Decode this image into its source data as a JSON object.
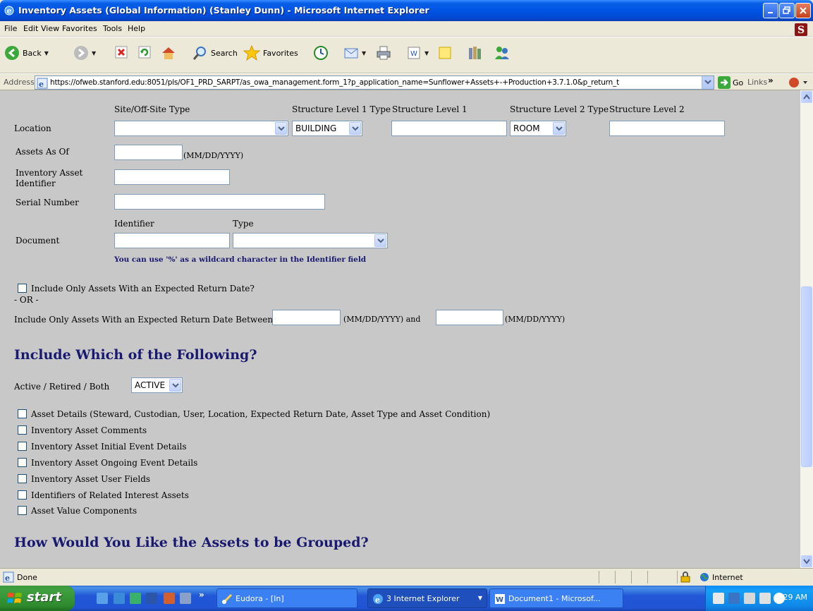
{
  "window": {
    "title": "Inventory Assets (Global Information) (Stanley Dunn) - Microsoft Internet Explorer"
  },
  "menu": [
    "File",
    "Edit",
    "View",
    "Favorites",
    "Tools",
    "Help"
  ],
  "toolbar": {
    "back_label": "Back",
    "search_label": "Search",
    "favorites_label": "Favorites"
  },
  "address": {
    "label": "Address",
    "url": "https://ofweb.stanford.edu:8051/pls/OF1_PRD_SARPT/as_owa_management.form_1?p_application_name=Sunflower+Assets+-+Production+3.7.1.0&p_return_t",
    "go_label": "Go",
    "links_label": "Links"
  },
  "form": {
    "location": {
      "label": "Location",
      "col_site": "Site/Off-Site Type",
      "col_s1_type": "Structure Level 1 Type",
      "col_s1": "Structure Level 1",
      "col_s2_type": "Structure Level 2 Type",
      "col_s2": "Structure Level 2",
      "site_value": "",
      "s1_type_value": "BUILDING",
      "s2_type_value": "ROOM"
    },
    "assets_as_of": {
      "label": "Assets As Of",
      "hint": "(MM/DD/YYYY)"
    },
    "inv_asset_id": {
      "label_line1": "Inventory Asset",
      "label_line2": "Identifier"
    },
    "serial_number": {
      "label": "Serial Number"
    },
    "document": {
      "label": "Document",
      "col_identifier": "Identifier",
      "col_type": "Type",
      "note": "You can use '%' as a wildcard character in the Identifier field"
    },
    "return_date": {
      "checkbox_label": "Include Only Assets With an Expected Return Date?",
      "or_label": "- OR -",
      "between_label": "Include Only Assets With an Expected Return Date Between",
      "hint1": "(MM/DD/YYYY) and",
      "hint2": "(MM/DD/YYYY)"
    },
    "include_heading": "Include Which of the Following?",
    "status": {
      "label": "Active / Retired / Both",
      "value": "ACTIVE"
    },
    "options": [
      "Asset Details (Steward, Custodian, User, Location, Expected Return Date, Asset Type and Asset Condition)",
      "Inventory Asset Comments",
      "Inventory Asset Initial Event Details",
      "Inventory Asset Ongoing Event Details",
      "Inventory Asset User Fields",
      "Identifiers of Related Interest Assets",
      "Asset Value Components"
    ],
    "group_heading": "How Would You Like the Assets to be Grouped?"
  },
  "status": {
    "text": "Done",
    "zone": "Internet"
  },
  "taskbar": {
    "start_label": "start",
    "tasks": [
      "Eudora - [In]",
      "3 Internet Explorer",
      "Document1 - Microsof..."
    ],
    "clock": "9:29 AM"
  },
  "colors": {
    "heading": "#191970",
    "page_bg": "#c8c8c8",
    "titlebar": "#0054e3"
  }
}
